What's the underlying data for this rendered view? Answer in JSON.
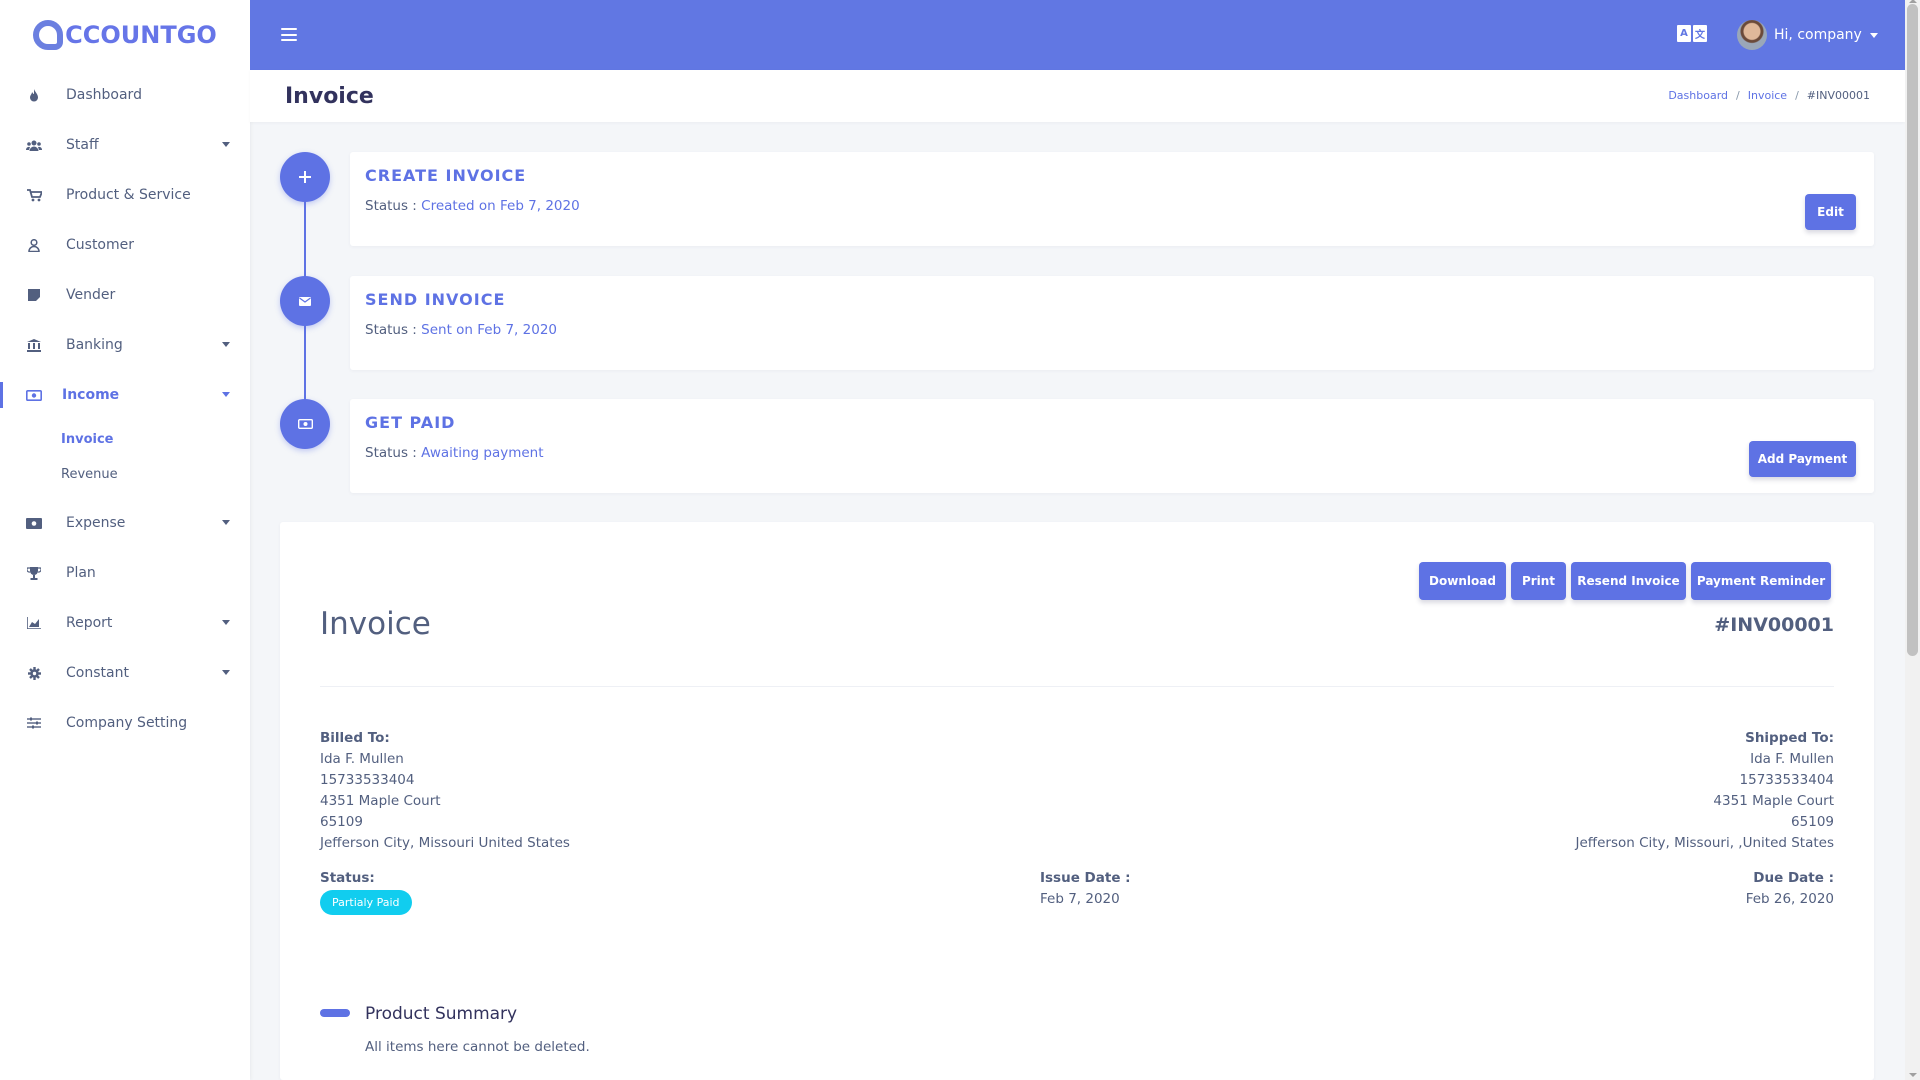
{
  "brand": {
    "logo_text": "CCOUNTGO"
  },
  "sidebar": {
    "items": [
      {
        "label": "Dashboard"
      },
      {
        "label": "Staff"
      },
      {
        "label": "Product & Service"
      },
      {
        "label": "Customer"
      },
      {
        "label": "Vender"
      },
      {
        "label": "Banking"
      },
      {
        "label": "Income"
      },
      {
        "label": "Expense"
      },
      {
        "label": "Plan"
      },
      {
        "label": "Report"
      },
      {
        "label": "Constant"
      },
      {
        "label": "Company Setting"
      }
    ],
    "income_sub": [
      {
        "label": "Invoice"
      },
      {
        "label": "Revenue"
      }
    ]
  },
  "topbar": {
    "lang_glyphs": [
      "A",
      "文"
    ],
    "user_greeting": "Hi, company"
  },
  "header": {
    "title": "Invoice",
    "breadcrumb": [
      "Dashboard",
      "Invoice",
      "#INV00001"
    ]
  },
  "timeline": {
    "status_prefix": "Status : ",
    "create": {
      "title": "CREATE INVOICE",
      "status": "Created on Feb 7, 2020",
      "button": "Edit"
    },
    "send": {
      "title": "SEND INVOICE",
      "status": "Sent on Feb 7, 2020"
    },
    "paid": {
      "title": "GET PAID",
      "status": "Awaiting payment",
      "button": "Add Payment"
    }
  },
  "invoice": {
    "actions": {
      "download": "Download",
      "print": "Print",
      "resend": "Resend Invoice",
      "reminder": "Payment Reminder"
    },
    "heading": "Invoice",
    "number": "#INV00001",
    "billed_to": {
      "label": "Billed To:",
      "name": "Ida F. Mullen",
      "phone": "15733533404",
      "street": "4351 Maple Court",
      "zip": "65109",
      "city": "Jefferson City, Missouri United States"
    },
    "shipped_to": {
      "label": "Shipped To:",
      "name": "Ida F. Mullen",
      "phone": "15733533404",
      "street": "4351 Maple Court",
      "zip": "65109",
      "city": "Jefferson City, Missouri, ,United States"
    },
    "status": {
      "label": "Status:",
      "value": "Partialy Paid"
    },
    "issue_date": {
      "label": "Issue Date :",
      "value": "Feb 7, 2020"
    },
    "due_date": {
      "label": "Due Date :",
      "value": "Feb 26, 2020"
    },
    "summary": {
      "title": "Product Summary",
      "subtitle": "All items here cannot be deleted."
    }
  },
  "colors": {
    "primary": "#5e72e4",
    "topbar": "#6177e3",
    "badge": "#11cdef",
    "text": "#525f7f"
  }
}
